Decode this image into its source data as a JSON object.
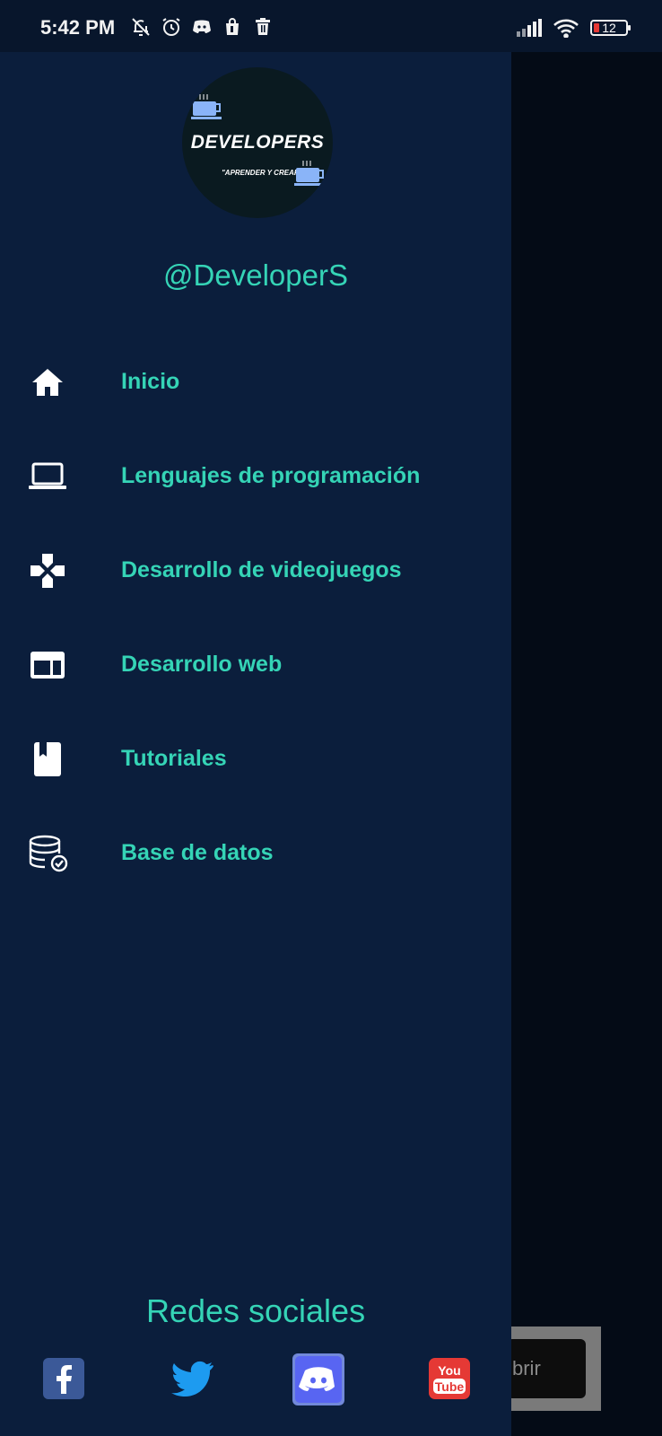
{
  "status_bar": {
    "time": "5:42 PM",
    "battery": "12"
  },
  "drawer": {
    "logo": {
      "title": "DEVELOPERS",
      "subtitle": "\"APRENDER Y CREAR\""
    },
    "username": "@DeveloperS",
    "menu": [
      {
        "label": "Inicio",
        "icon": "home-icon"
      },
      {
        "label": "Lenguajes de programación",
        "icon": "laptop-icon"
      },
      {
        "label": "Desarrollo de videojuegos",
        "icon": "gamepad-icon"
      },
      {
        "label": "Desarrollo web",
        "icon": "web-layout-icon"
      },
      {
        "label": "Tutoriales",
        "icon": "book-icon"
      },
      {
        "label": "Base de datos",
        "icon": "database-icon"
      }
    ],
    "social_title": "Redes sociales",
    "social": [
      {
        "name": "facebook-icon",
        "color": "#3b5998"
      },
      {
        "name": "twitter-icon",
        "color": "#1d9bf0"
      },
      {
        "name": "discord-icon",
        "color": "#5865f2"
      },
      {
        "name": "youtube-icon",
        "color": "#e53935"
      }
    ]
  },
  "background": {
    "button_text": "brir"
  },
  "colors": {
    "accent": "#35d4b6",
    "drawer_bg": "#0b1e3c",
    "status_bg": "#08162c"
  }
}
